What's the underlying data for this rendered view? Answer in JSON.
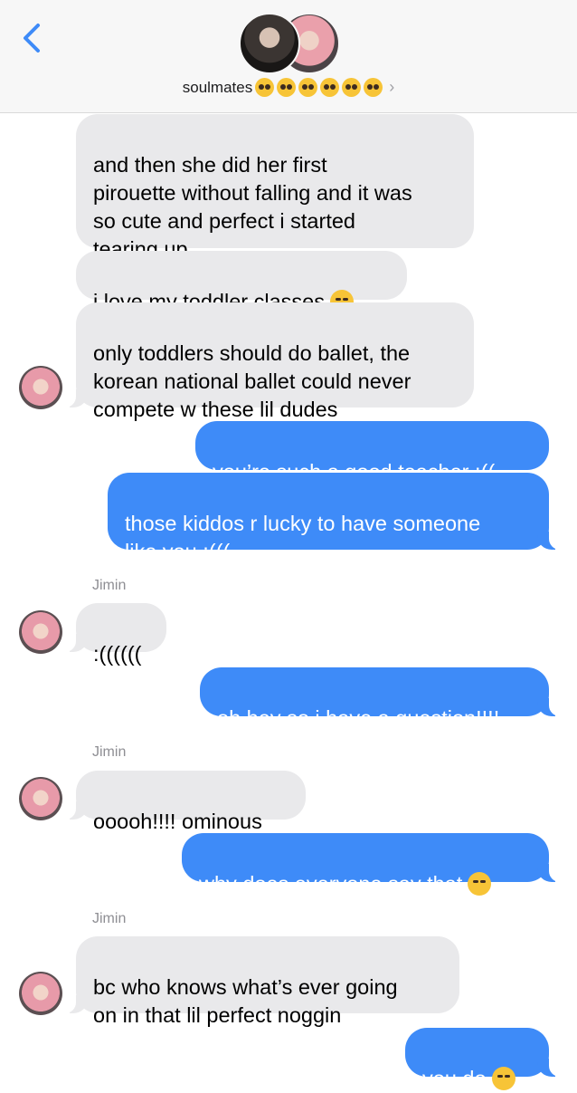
{
  "header": {
    "back_icon": "chevron-left-icon",
    "title": "soulmates",
    "title_emojis": [
      "🥺",
      "🥺",
      "🥺",
      "🥺",
      "🥺",
      "🥺"
    ],
    "chevron": "›",
    "accent": "#3e8bf8"
  },
  "messages": [
    {
      "dir": "in",
      "text": "and then she did her first\npirouette without falling and it was\nso cute and perfect i started\ntearing up"
    },
    {
      "dir": "in",
      "text": "i love my toddler classes",
      "emoji": "😭"
    },
    {
      "dir": "in",
      "text": "only toddlers should do ballet, the\nkorean national ballet could never\ncompete w these lil dudes"
    },
    {
      "dir": "out",
      "text": "you’re such a good teacher :(("
    },
    {
      "dir": "out",
      "text": "those kiddos r lucky to have someone\nlike you :((("
    },
    {
      "dir": "in",
      "sender": "Jimin",
      "text": ":(((((("
    },
    {
      "dir": "out",
      "text": "oh hey so i have a question!!!!"
    },
    {
      "dir": "in",
      "sender": "Jimin",
      "text": "ooooh!!!! ominous"
    },
    {
      "dir": "out",
      "text": "why does everyone say that",
      "emoji": "😞"
    },
    {
      "dir": "in",
      "sender": "Jimin",
      "text": "bc who knows what’s ever going\non in that lil perfect noggin"
    },
    {
      "dir": "out",
      "text": "you do",
      "emoji": "😌"
    }
  ]
}
